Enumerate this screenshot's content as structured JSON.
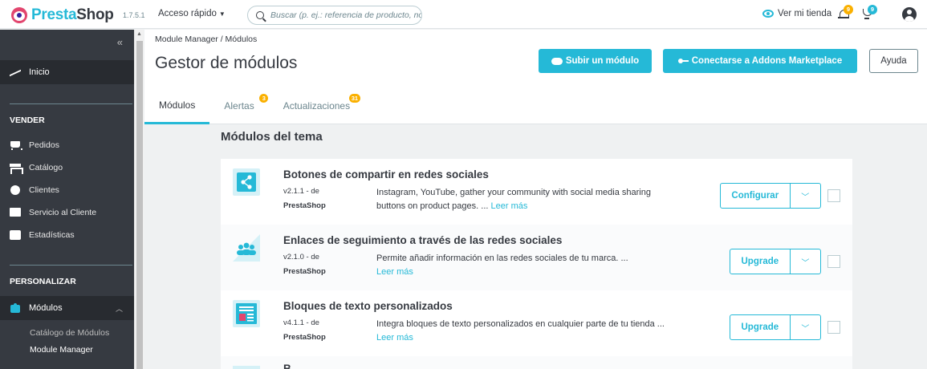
{
  "topbar": {
    "logo_brand": "Presta",
    "logo_suffix": "Shop",
    "version": "1.7.5.1",
    "quick_access": "Acceso rápido",
    "search_placeholder": "Buscar (p. ej.: referencia de producto, no",
    "view_store": "Ver mi tienda",
    "notif_orders": "9",
    "notif_trophy": "9"
  },
  "sidebar": {
    "inicio": "Inicio",
    "section_sell": "VENDER",
    "sell_items": [
      "Pedidos",
      "Catálogo",
      "Clientes",
      "Servicio al Cliente",
      "Estadísticas"
    ],
    "section_customize": "PERSONALIZAR",
    "modules": "Módulos",
    "sub_items": [
      "Catálogo de Módulos",
      "Module Manager"
    ]
  },
  "header": {
    "breadcrumb": "Module Manager  /  Módulos",
    "title": "Gestor de módulos",
    "upload_label": "Subir un módulo",
    "addons_label": "Conectarse a Addons Marketplace",
    "help_label": "Ayuda",
    "tabs": [
      {
        "label": "Módulos",
        "badge": ""
      },
      {
        "label": "Alertas",
        "badge": "3"
      },
      {
        "label": "Actualizaciones",
        "badge": "31"
      }
    ]
  },
  "content": {
    "section_title": "Módulos del tema",
    "modules": [
      {
        "name": "Botones de compartir en redes sociales",
        "version": "v2.1.1 - de",
        "author": "PrestaShop",
        "description": "Instagram, YouTube, gather your community with social media sharing buttons on product pages. ...",
        "more": "Leer más",
        "action": "Configurar"
      },
      {
        "name": "Enlaces de seguimiento a través de las redes sociales",
        "version": "v2.1.0 - de",
        "author": "PrestaShop",
        "description": "Permite añadir información en las redes sociales de tu marca. ...",
        "more": "Leer más",
        "action": "Upgrade"
      },
      {
        "name": "Bloques de texto personalizados",
        "version": "v4.1.1 - de",
        "author": "PrestaShop",
        "description": "Integra bloques de texto personalizados en cualquier parte de tu tienda ...",
        "more": "Leer más",
        "action": "Upgrade"
      }
    ],
    "partial_next_name": "B"
  },
  "colors": {
    "accent": "#25b9d7",
    "sidebar": "#363a41",
    "badge": "#fab000"
  }
}
